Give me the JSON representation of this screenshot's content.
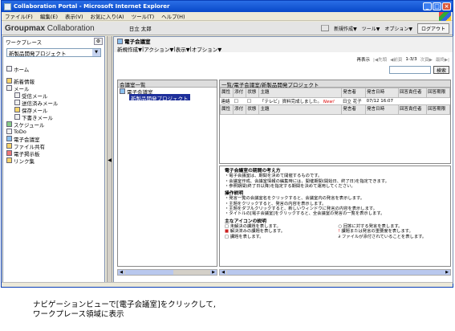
{
  "window": {
    "title": "Collaboration Portal - Microsoft Internet Explorer",
    "min": "_",
    "max": "□",
    "close": "×"
  },
  "menubar": [
    "ファイル(F)",
    "編集(E)",
    "表示(V)",
    "お気に入り(A)",
    "ツール(T)",
    "ヘルプ(H)"
  ],
  "header": {
    "logo_bold": "Groupmax",
    "logo_rest": " Collaboration",
    "user": "日立 太郎",
    "new": "新規作成▼",
    "tools": "ツール▼",
    "options": "オプション▼",
    "logout": "ログアウト"
  },
  "workplace": {
    "label": "ワークプレース",
    "selected": "新製品開発プロジェクト",
    "items": [
      {
        "label": "ホーム",
        "icon": "home-icon"
      },
      {
        "label": "新着情報",
        "icon": "news-icon"
      },
      {
        "label": "メール",
        "icon": "mail-icon"
      },
      {
        "label": "受信メール",
        "icon": "inbox-icon"
      },
      {
        "label": "送信済みメール",
        "icon": "sent-mail-icon"
      },
      {
        "label": "保存メール",
        "icon": "saved-mail-icon"
      },
      {
        "label": "下書きメール",
        "icon": "draft-mail-icon"
      },
      {
        "label": "スケジュール",
        "icon": "schedule-icon"
      },
      {
        "label": "ToDo",
        "icon": "todo-icon"
      },
      {
        "label": "電子会議室",
        "icon": "meeting-room-icon"
      },
      {
        "label": "ファイル共有",
        "icon": "file-share-icon"
      },
      {
        "label": "電子掲示板",
        "icon": "bulletin-icon"
      },
      {
        "label": "リンク集",
        "icon": "links-icon"
      }
    ]
  },
  "main": {
    "title": "電子会議室",
    "toolbar": [
      "新規作成▼",
      "アクション▼",
      "表示▼",
      "オプション▼"
    ],
    "refresh": "再表示",
    "paging": {
      "first": "|◀先頭",
      "prev": "◀前頁",
      "range": "1-3/3",
      "next": "次頁▶",
      "last": "最終▶|"
    },
    "search_btn": "検索",
    "tree": {
      "header": "会議室一覧",
      "root": "電子会議室",
      "selected": "新製品開発プロジェクト"
    },
    "list": {
      "path": "一覧/電子会議室/新製品開発プロジェクト",
      "columns": [
        "属性",
        "添付",
        "状態",
        "主題",
        "発言者",
        "発言日時",
        "回答責任者",
        "回答期限"
      ],
      "rows": [
        {
          "attr": "連絡",
          "subject": "「テレビ」資料完成しました。",
          "new": "New!",
          "author": "日立 花子",
          "date": "07/12 16:07"
        }
      ]
    },
    "help": {
      "h1": "電子会議室の期間の考え方",
      "p1": "・電子会議室は、期間を決めて開催するものです。",
      "p2": "・会議室作成、会議室情報の編集時には、開催期間(開始日、終了日)を指定できます。",
      "p3": "・参照期間(終了日以降)を指定する期間を決めて運用してください。",
      "h2": "操作説明",
      "p4": "・発言一覧の会議室名をクリックすると、会議室内の発言を表示します。",
      "p5": "・主題をクリックすると、発言の内容を表示します。",
      "p6": "・主題をダブルクリックすると、新しいウィンドウに発言の内容を表示します。",
      "p7": "・タイトルの[電子会議室]をクリックすると、全会議室の発言の一覧を表示します。",
      "h3": "主なアイコンの説明",
      "icons": [
        "未解決の課題を表します。",
        "回答に対する発言を表します。",
        "解決済みの課題を表します。",
        "課題または発言の重要度を表します。",
        "課題を表します。",
        "ファイルが添付されていることを表します。"
      ]
    }
  },
  "caption": {
    "line1": "ナビゲーションビューで[電子会議室]をクリックして,",
    "line2": "ワークプレース領域に表示"
  }
}
